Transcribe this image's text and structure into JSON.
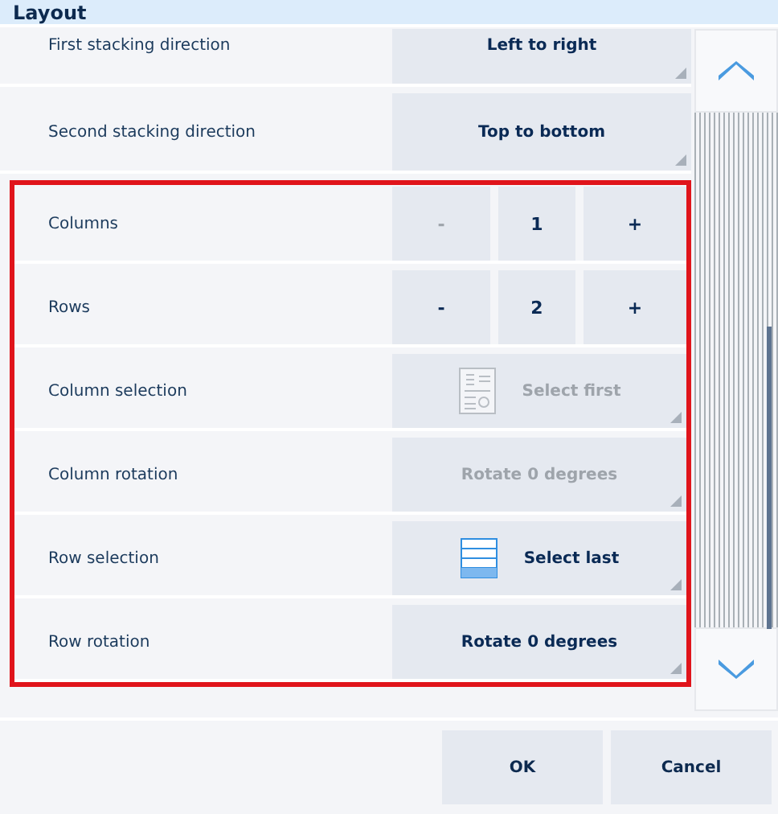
{
  "window": {
    "title": "Layout"
  },
  "settings": [
    {
      "kind": "select",
      "label": "First stacking direction",
      "value": "Left to right",
      "disabled": false,
      "highlighted": false
    },
    {
      "kind": "select",
      "label": "Second stacking direction",
      "value": "Top to bottom",
      "disabled": false,
      "highlighted": false
    },
    {
      "kind": "stepper",
      "label": "Columns",
      "minus": "-",
      "value": "1",
      "plus": "+",
      "minus_disabled": true,
      "highlighted": true
    },
    {
      "kind": "stepper",
      "label": "Rows",
      "minus": "-",
      "value": "2",
      "plus": "+",
      "minus_disabled": false,
      "highlighted": true
    },
    {
      "kind": "docselect",
      "label": "Column selection",
      "value": "Select first",
      "disabled": true,
      "highlighted": true
    },
    {
      "kind": "select",
      "label": "Column rotation",
      "value": "Rotate 0 degrees",
      "disabled": true,
      "highlighted": true
    },
    {
      "kind": "rowselect",
      "label": "Row selection",
      "value": "Select last",
      "disabled": false,
      "highlighted": true
    },
    {
      "kind": "select",
      "label": "Row rotation",
      "value": "Rotate 0 degrees",
      "disabled": false,
      "highlighted": true
    }
  ],
  "buttons": [
    {
      "label": "OK"
    },
    {
      "label": "Cancel"
    }
  ]
}
